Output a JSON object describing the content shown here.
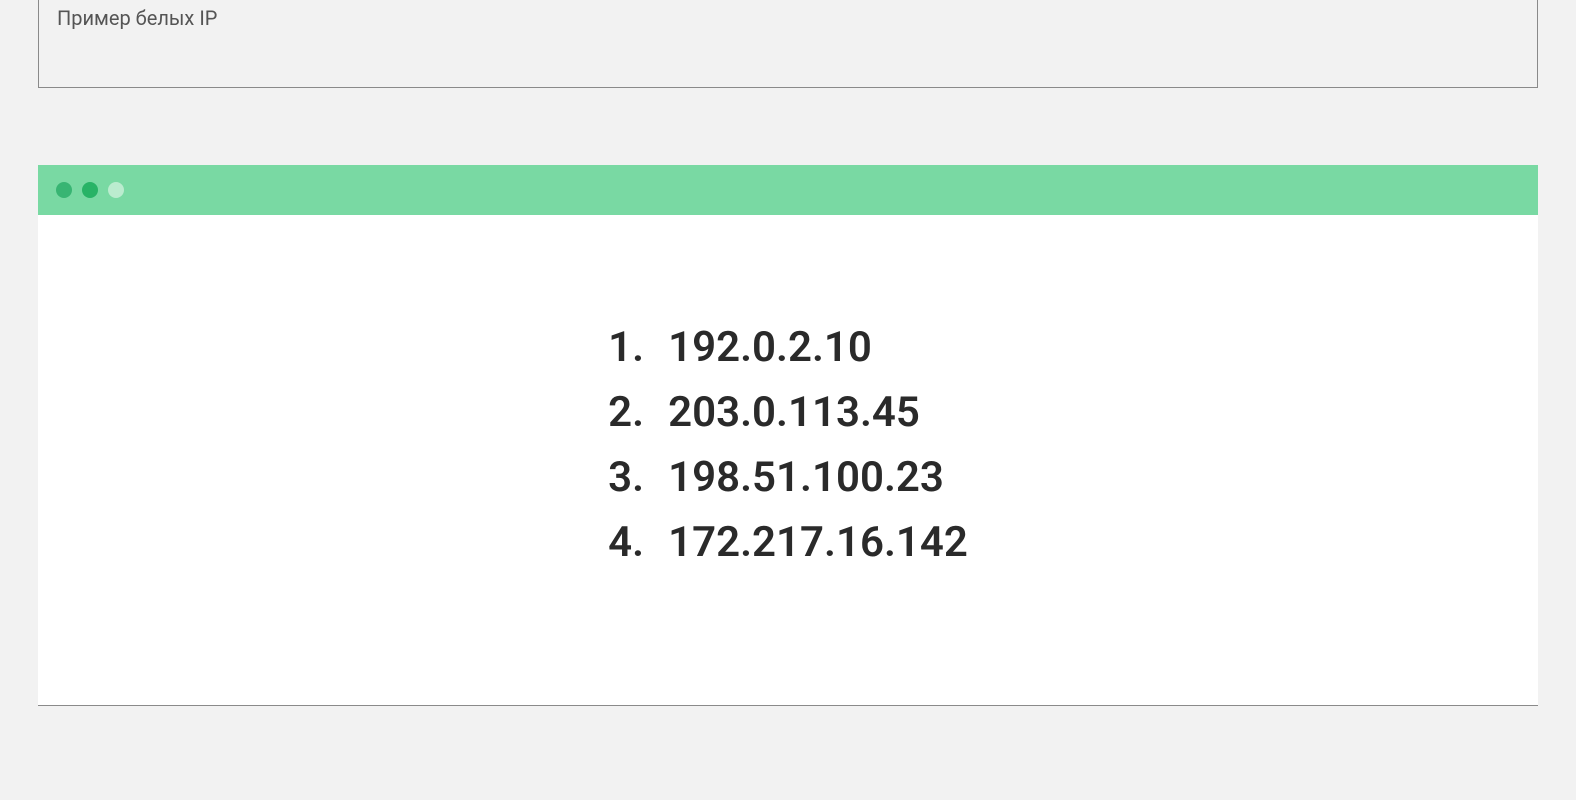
{
  "header": {
    "label": "Пример белых IP"
  },
  "ip_list": {
    "items": [
      {
        "n": "1.",
        "ip": "192.0.2.10"
      },
      {
        "n": "2.",
        "ip": "203.0.113.45"
      },
      {
        "n": "3.",
        "ip": "198.51.100.23"
      },
      {
        "n": "4.",
        "ip": "172.217.16.142"
      }
    ]
  },
  "colors": {
    "titlebar": "#79d9a3"
  }
}
